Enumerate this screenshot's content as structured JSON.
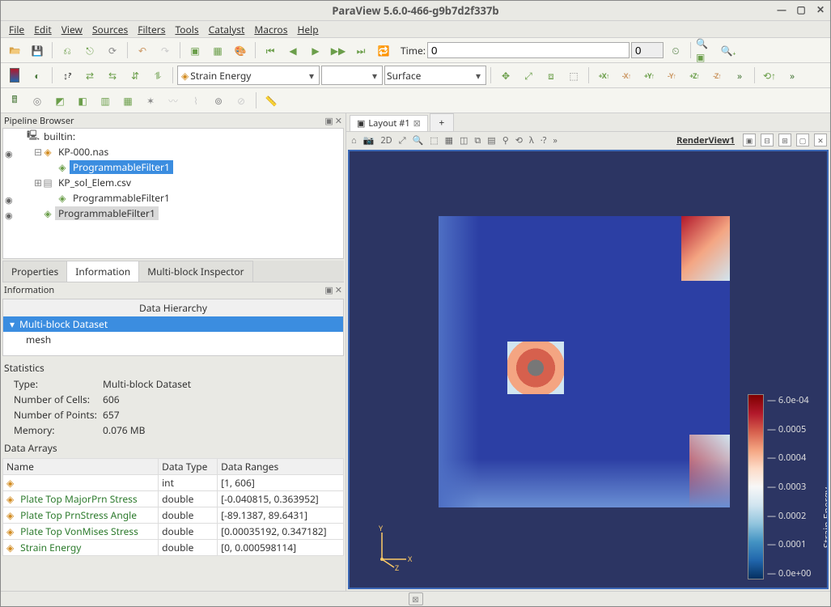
{
  "title": "ParaView 5.6.0-466-g9b7d2f337b",
  "menu": [
    "File",
    "Edit",
    "View",
    "Sources",
    "Filters",
    "Tools",
    "Catalyst",
    "Macros",
    "Help"
  ],
  "time": {
    "label": "Time:",
    "value": "0",
    "index": "0"
  },
  "active_array": "Strain Energy",
  "representation": "Surface",
  "pipeline": {
    "title": "Pipeline Browser",
    "items": [
      {
        "indent": 0,
        "vis": false,
        "icon": "server",
        "label": "builtin:",
        "sel": "none"
      },
      {
        "indent": 1,
        "vis": true,
        "icon": "cube-orange",
        "label": "KP-000.nas",
        "sel": "none",
        "exp": "minus"
      },
      {
        "indent": 2,
        "vis": false,
        "icon": "cube-green",
        "label": "ProgrammableFilter1",
        "sel": "blue"
      },
      {
        "indent": 1,
        "vis": false,
        "icon": "table",
        "label": "KP_sol_Elem.csv",
        "sel": "none",
        "exp": "plus"
      },
      {
        "indent": 2,
        "vis": true,
        "icon": "cube-green",
        "label": "ProgrammableFilter1",
        "sel": "none"
      },
      {
        "indent": 1,
        "vis": true,
        "icon": "cube-green",
        "label": "ProgrammableFilter1",
        "sel": "grey"
      }
    ]
  },
  "tabs": {
    "items": [
      "Properties",
      "Information",
      "Multi-block Inspector"
    ],
    "active": 1
  },
  "info": {
    "title": "Information",
    "hierarchy": {
      "title": "Data Hierarchy",
      "rows": [
        {
          "label": "Multi-block Dataset",
          "sel": true
        },
        {
          "label": "mesh",
          "sel": false,
          "indent": 1
        }
      ]
    },
    "stats_title": "Statistics",
    "stats": [
      {
        "k": "Type:",
        "v": "Multi-block Dataset"
      },
      {
        "k": "Number of Cells:",
        "v": "606"
      },
      {
        "k": "Number of Points:",
        "v": "657"
      },
      {
        "k": "Memory:",
        "v": "0.076 MB"
      }
    ],
    "arrays_title": "Data Arrays",
    "arrays_headers": [
      "Name",
      "Data Type",
      "Data Ranges"
    ],
    "arrays": [
      {
        "name": "",
        "type": "int",
        "range": "[1, 606]"
      },
      {
        "name": "Plate Top MajorPrn Stress",
        "type": "double",
        "range": "[-0.040815, 0.363952]"
      },
      {
        "name": "Plate Top PrnStress Angle",
        "type": "double",
        "range": "[-89.1387, 89.6431]"
      },
      {
        "name": "Plate Top VonMises Stress",
        "type": "double",
        "range": "[0.00035192, 0.347182]"
      },
      {
        "name": "Strain Energy",
        "type": "double",
        "range": "[0, 0.000598114]"
      }
    ]
  },
  "layout": {
    "tab": "Layout #1",
    "view": "RenderView1"
  },
  "render_toolbar": [
    "⌂",
    "📷",
    "2D",
    "⤢",
    "🔍",
    "⬚",
    "▦",
    "◫",
    "⧉",
    "▤",
    "⚲",
    "⟲",
    "λ",
    "·?",
    "»"
  ],
  "colorbar": {
    "ticks": [
      "6.0e-04",
      "0.0005",
      "0.0004",
      "0.0003",
      "0.0002",
      "0.0001",
      "0.0e+00"
    ],
    "label": "Strain Energy"
  },
  "triad": {
    "x": "X",
    "y": "Y",
    "z": "Z"
  }
}
